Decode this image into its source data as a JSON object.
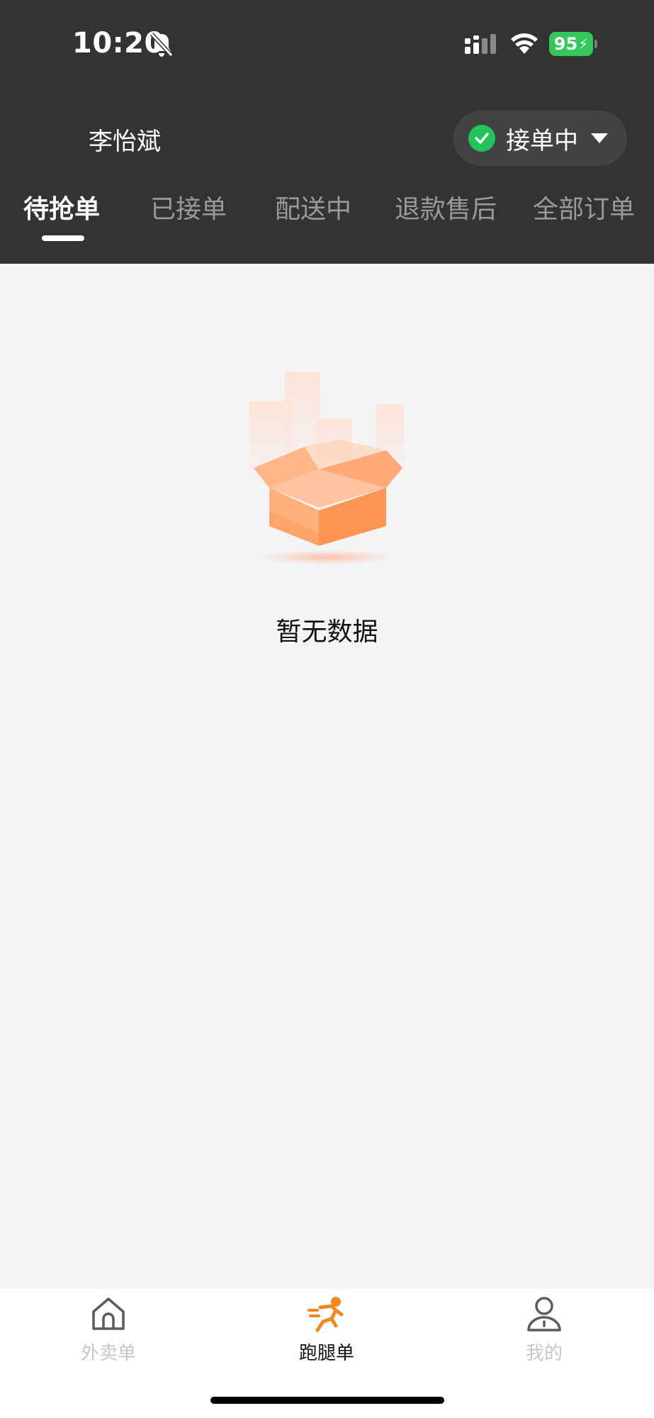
{
  "status_bar": {
    "time": "10:20",
    "battery": "95",
    "icons": [
      "bell-slash-icon",
      "cellular-signal-icon",
      "wifi-icon",
      "battery-charging-icon"
    ]
  },
  "header": {
    "user_name": "李怡斌",
    "status_pill": {
      "label": "接单中",
      "icon": "check-circle-icon",
      "accent": "#21c35b"
    }
  },
  "tabs": [
    {
      "label": "待抢单",
      "active": true
    },
    {
      "label": "已接单",
      "active": false
    },
    {
      "label": "配送中",
      "active": false
    },
    {
      "label": "退款售后",
      "active": false
    },
    {
      "label": "全部订单",
      "active": false
    }
  ],
  "empty_state": {
    "message": "暂无数据",
    "icon": "empty-box-icon"
  },
  "bottom_nav": [
    {
      "label": "外卖单",
      "icon": "home-icon",
      "active": false
    },
    {
      "label": "跑腿单",
      "icon": "runner-icon",
      "active": true,
      "accent": "#f5871f"
    },
    {
      "label": "我的",
      "icon": "user-icon",
      "active": false
    }
  ],
  "colors": {
    "header_bg": "#333333",
    "content_bg": "#f3f4f6",
    "inactive_nav": "#c4c6cc"
  }
}
